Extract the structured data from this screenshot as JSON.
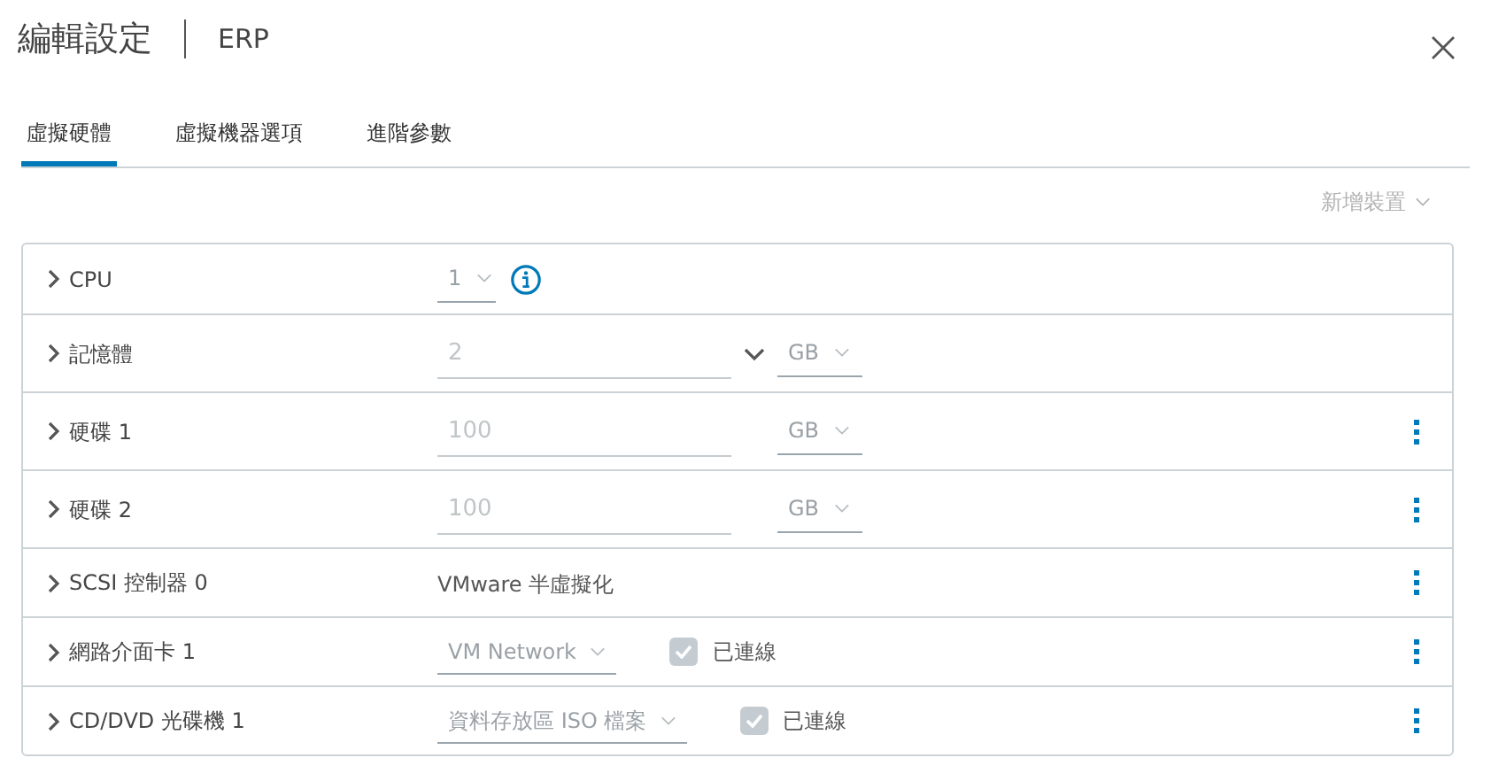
{
  "window": {
    "title": "編輯設定",
    "subtitle": "ERP"
  },
  "tabs": [
    {
      "label": "虛擬硬體",
      "selected": true
    },
    {
      "label": "虛擬機器選項",
      "selected": false
    },
    {
      "label": "進階參數",
      "selected": false
    }
  ],
  "add_device": {
    "label": "新增裝置",
    "disabled": true
  },
  "devices": [
    {
      "kind": "select",
      "label": "CPU",
      "value": "1",
      "info": true,
      "menu": false
    },
    {
      "kind": "size",
      "label": "記憶體",
      "value": "2",
      "unit": "GB",
      "dropdown": true,
      "menu": false
    },
    {
      "kind": "size",
      "label": "硬碟 1",
      "value": "100",
      "unit": "GB",
      "dropdown": false,
      "menu": true
    },
    {
      "kind": "size",
      "label": "硬碟 2",
      "value": "100",
      "unit": "GB",
      "dropdown": false,
      "menu": true
    },
    {
      "kind": "text",
      "label": "SCSI 控制器 0",
      "value": "VMware 半虛擬化",
      "menu": true
    },
    {
      "kind": "connect",
      "label": "網路介面卡 1",
      "value": "VM Network",
      "connected_label": "已連線",
      "connected": true,
      "menu": true
    },
    {
      "kind": "connect",
      "label": "CD/DVD 光碟機 1",
      "value": "資料存放區 ISO 檔案",
      "connected_label": "已連線",
      "connected": true,
      "menu": true
    }
  ]
}
